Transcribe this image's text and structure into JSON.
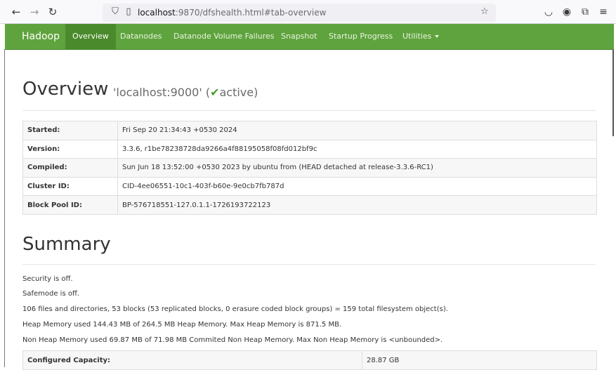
{
  "browser": {
    "url_host": "localhost",
    "url_rest": ":9870/dfshealth.html#tab-overview"
  },
  "nav": {
    "brand": "Hadoop",
    "items": [
      {
        "label": "Overview",
        "active": true
      },
      {
        "label": "Datanodes"
      },
      {
        "label": "Datanode Volume Failures"
      },
      {
        "label": "Snapshot"
      },
      {
        "label": "Startup Progress"
      },
      {
        "label": "Utilities"
      }
    ]
  },
  "overview": {
    "title": "Overview",
    "host": "'localhost:9000' (",
    "status_check": "✔",
    "status": "active)",
    "rows": [
      {
        "key": "Started:",
        "value": "Fri Sep 20 21:34:43 +0530 2024"
      },
      {
        "key": "Version:",
        "value": "3.3.6, r1be78238728da9266a4f88195058f08fd012bf9c"
      },
      {
        "key": "Compiled:",
        "value": "Sun Jun 18 13:52:00 +0530 2023 by ubuntu from (HEAD detached at release-3.3.6-RC1)"
      },
      {
        "key": "Cluster ID:",
        "value": "CID-4ee06551-10c1-403f-b60e-9e0cb7fb787d"
      },
      {
        "key": "Block Pool ID:",
        "value": "BP-576718551-127.0.1.1-1726193722123"
      }
    ]
  },
  "summary": {
    "title": "Summary",
    "lines": [
      "Security is off.",
      "Safemode is off.",
      "106 files and directories, 53 blocks (53 replicated blocks, 0 erasure coded block groups) = 159 total filesystem object(s).",
      "Heap Memory used 144.43 MB of 264.5 MB Heap Memory. Max Heap Memory is 871.5 MB.",
      "Non Heap Memory used 69.87 MB of 71.98 MB Commited Non Heap Memory. Max Non Heap Memory is <unbounded>."
    ],
    "capacity_key": "Configured Capacity:",
    "capacity_value": "28.87 GB"
  }
}
